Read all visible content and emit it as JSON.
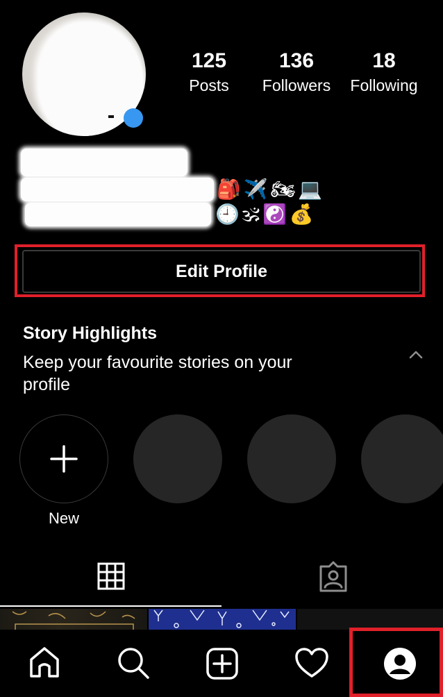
{
  "profile": {
    "stats": [
      {
        "value": "125",
        "label": "Posts"
      },
      {
        "value": "136",
        "label": "Followers"
      },
      {
        "value": "18",
        "label": "Following"
      }
    ],
    "bio_emoji_line1": "🎒✈️🏍💻",
    "bio_emoji_line2": "🕘🕉☯️💰"
  },
  "edit_profile_label": "Edit Profile",
  "highlights": {
    "title": "Story Highlights",
    "subtitle": "Keep your favourite stories on your profile",
    "new_label": "New"
  },
  "tabs": [
    {
      "icon": "grid-icon",
      "active": true
    },
    {
      "icon": "tagged-icon",
      "active": false
    }
  ],
  "bottom_nav": [
    "home-icon",
    "search-icon",
    "new-post-icon",
    "activity-heart-icon",
    "profile-icon"
  ],
  "colors": {
    "background": "#000000",
    "highlight_box": "#e0202a",
    "badge": "#3897f0"
  }
}
